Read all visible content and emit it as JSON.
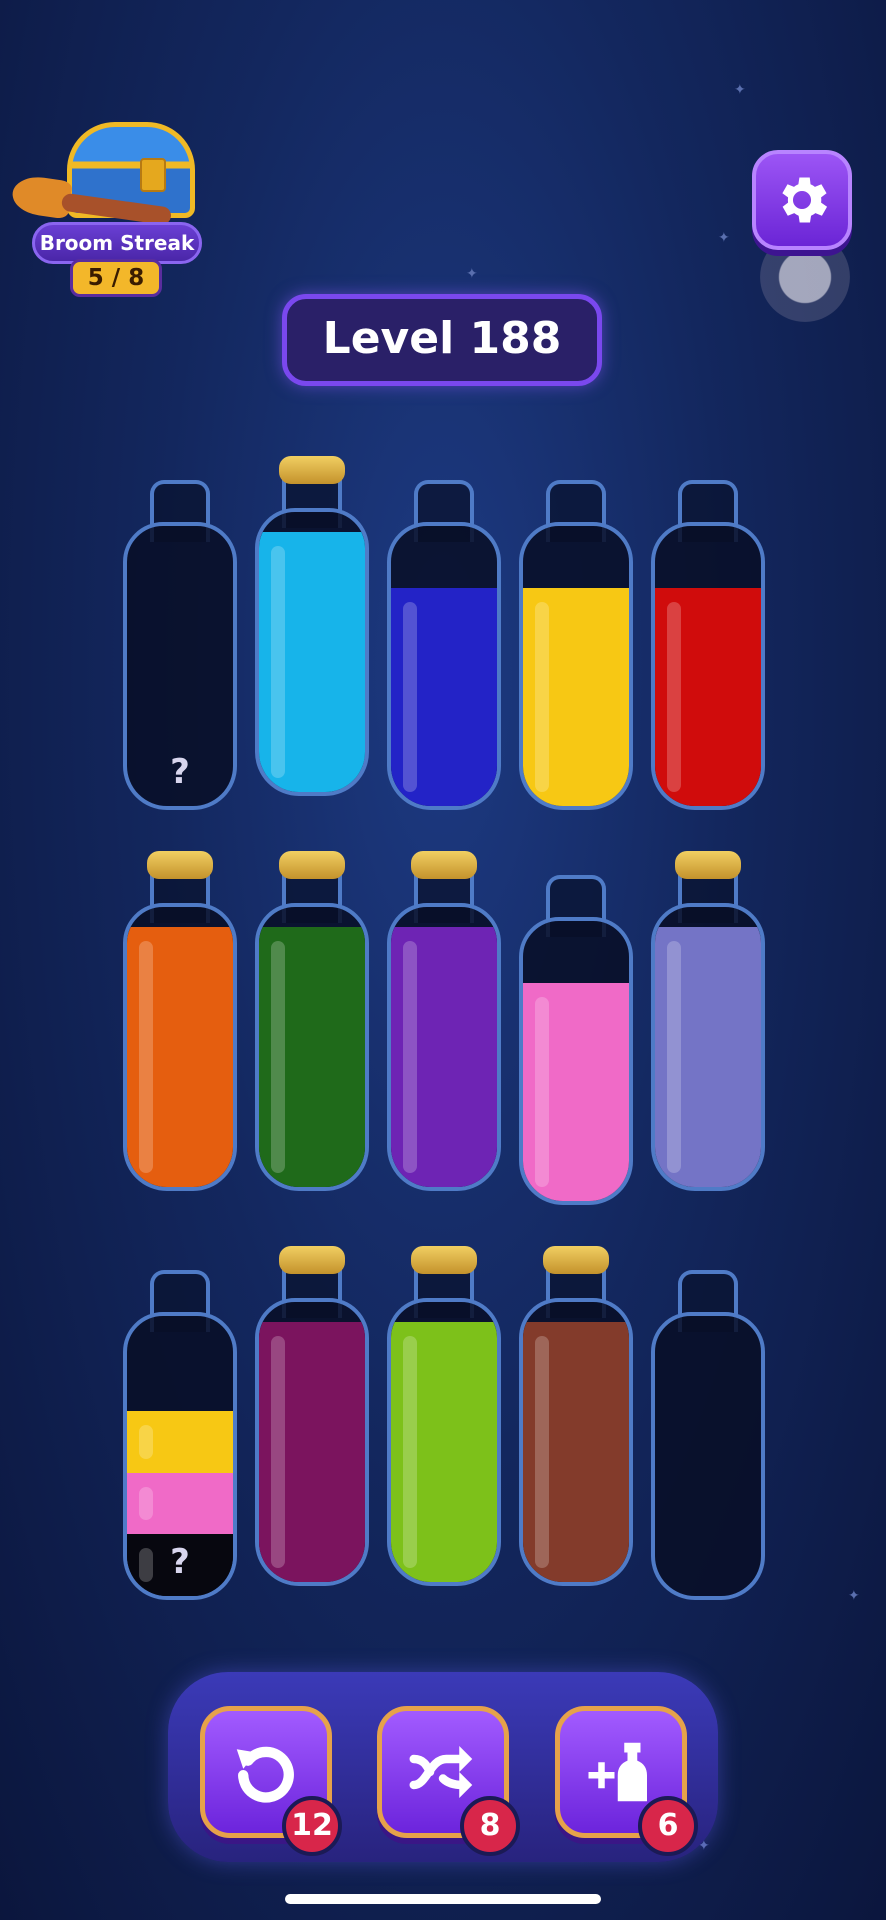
{
  "streak": {
    "label": "Broom Streak",
    "count": "5 / 8"
  },
  "level": {
    "label": "Level 188"
  },
  "colors": {
    "cyan": "#17b4ea",
    "blue": "#2323c7",
    "yellow": "#f7c814",
    "red": "#d00c0c",
    "orange": "#e55e0f",
    "green": "#1f6a1a",
    "purple": "#6e24b4",
    "pink": "#f06ac7",
    "lavender": "#7474c6",
    "magenta": "#7b145e",
    "lime": "#7dc11a",
    "brown": "#833b2b",
    "black": "#07070f"
  },
  "bottles": [
    {
      "corked": false,
      "layers": [],
      "hidden": "?"
    },
    {
      "corked": true,
      "layers": [
        "cyan"
      ]
    },
    {
      "corked": false,
      "layers": [
        "blue"
      ]
    },
    {
      "corked": false,
      "layers": [
        "yellow"
      ]
    },
    {
      "corked": false,
      "layers": [
        "red"
      ]
    },
    {
      "corked": true,
      "layers": [
        "orange"
      ]
    },
    {
      "corked": true,
      "layers": [
        "green"
      ]
    },
    {
      "corked": true,
      "layers": [
        "purple"
      ]
    },
    {
      "corked": false,
      "layers": [
        "pink"
      ]
    },
    {
      "corked": true,
      "layers": [
        "lavender"
      ]
    },
    {
      "corked": false,
      "layers": [
        "black",
        "pink",
        "yellow"
      ],
      "hidden": "?"
    },
    {
      "corked": true,
      "layers": [
        "magenta"
      ]
    },
    {
      "corked": true,
      "layers": [
        "lime"
      ]
    },
    {
      "corked": true,
      "layers": [
        "brown"
      ]
    },
    {
      "corked": false,
      "layers": []
    }
  ],
  "tools": [
    {
      "name": "undo",
      "icon": "undo-icon",
      "count": "12"
    },
    {
      "name": "shuffle",
      "icon": "shuffle-icon",
      "count": "8"
    },
    {
      "name": "add-bottle",
      "icon": "add-bottle-icon",
      "count": "6"
    }
  ]
}
